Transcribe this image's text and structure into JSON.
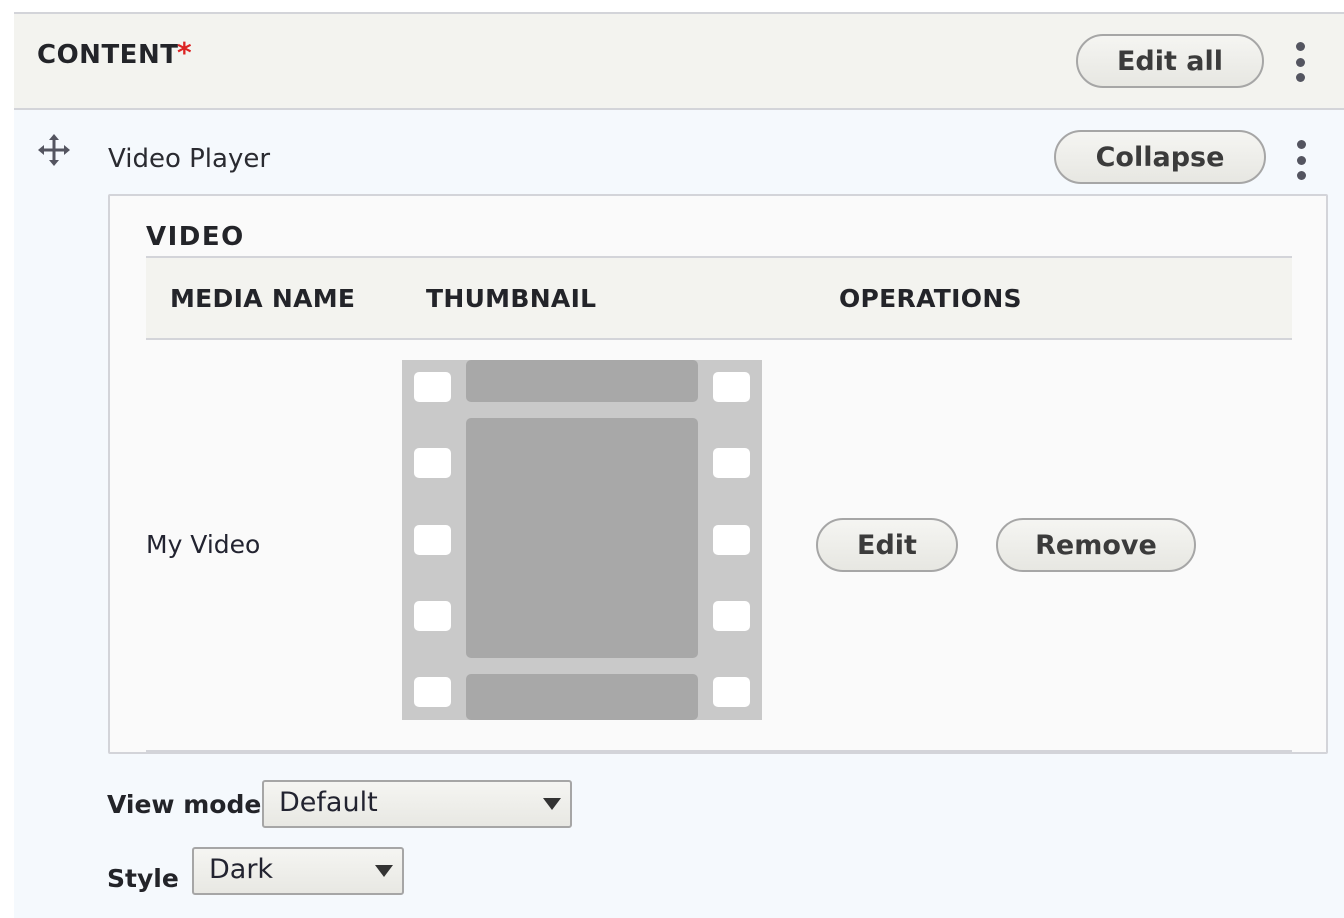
{
  "section": {
    "title": "CONTENT",
    "required_marker": "*",
    "edit_all_label": "Edit all",
    "more_actions_icon": "kebab-vertical-icon"
  },
  "paragraph": {
    "drag_icon": "move-arrows-icon",
    "label": "Video Player",
    "collapse_label": "Collapse",
    "more_actions_icon": "kebab-vertical-icon",
    "video_field": {
      "heading": "VIDEO",
      "columns": [
        "MEDIA NAME",
        "THUMBNAIL",
        "OPERATIONS"
      ],
      "rows": [
        {
          "media_name": "My Video",
          "thumbnail_icon": "film-strip-icon",
          "edit_label": "Edit",
          "remove_label": "Remove"
        }
      ]
    },
    "view_mode": {
      "label": "View mode",
      "value": "Default"
    },
    "style": {
      "label": "Style",
      "value": "Dark"
    }
  },
  "colors": {
    "required": "#dc2323",
    "header_bg": "#f3f3ef",
    "paragraph_bg": "#f5f9fd",
    "border": "#d3d4d9"
  }
}
